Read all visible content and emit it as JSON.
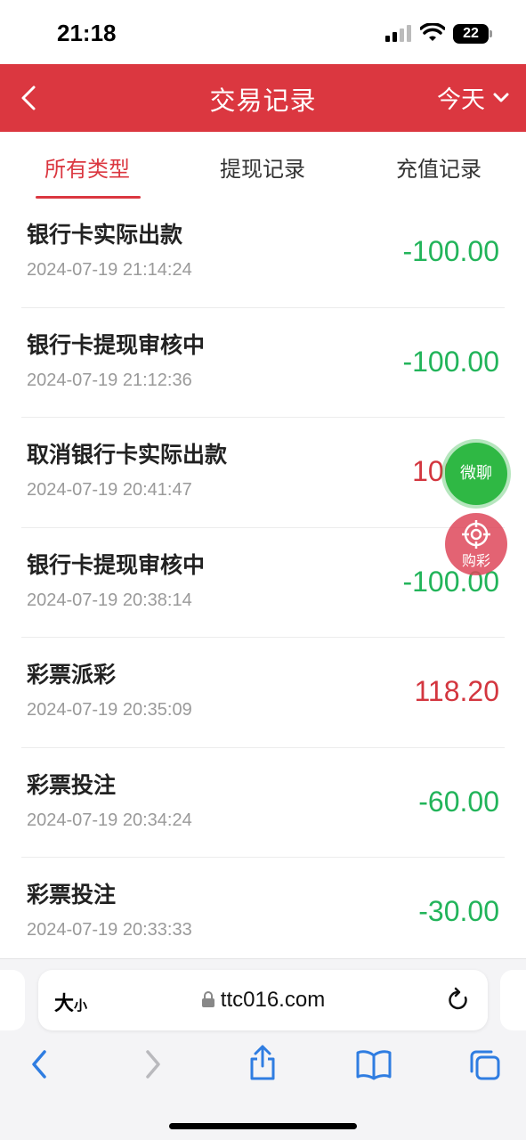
{
  "status_bar": {
    "time": "21:18",
    "battery": "22"
  },
  "header": {
    "title": "交易记录",
    "date_filter": "今天"
  },
  "tabs": [
    {
      "label": "所有类型",
      "active": true
    },
    {
      "label": "提现记录",
      "active": false
    },
    {
      "label": "充值记录",
      "active": false
    }
  ],
  "transactions": [
    {
      "title": "银行卡实际出款",
      "time": "2024-07-19 21:14:24",
      "amount": "-100.00"
    },
    {
      "title": "银行卡提现审核中",
      "time": "2024-07-19 21:12:36",
      "amount": "-100.00"
    },
    {
      "title": "取消银行卡实际出款",
      "time": "2024-07-19 20:41:47",
      "amount": "100.00"
    },
    {
      "title": "银行卡提现审核中",
      "time": "2024-07-19 20:38:14",
      "amount": "-100.00"
    },
    {
      "title": "彩票派彩",
      "time": "2024-07-19 20:35:09",
      "amount": "118.20"
    },
    {
      "title": "彩票投注",
      "time": "2024-07-19 20:34:24",
      "amount": "-60.00"
    },
    {
      "title": "彩票投注",
      "time": "2024-07-19 20:33:33",
      "amount": "-30.00"
    }
  ],
  "floating": {
    "chat_label": "微聊",
    "lottery_label": "购彩"
  },
  "browser": {
    "text_size_big": "大",
    "text_size_small": "小",
    "url": "ttc016.com"
  },
  "colors": {
    "brand_red": "#db3740",
    "negative_green": "#22b45a",
    "positive_red": "#d3363f"
  }
}
